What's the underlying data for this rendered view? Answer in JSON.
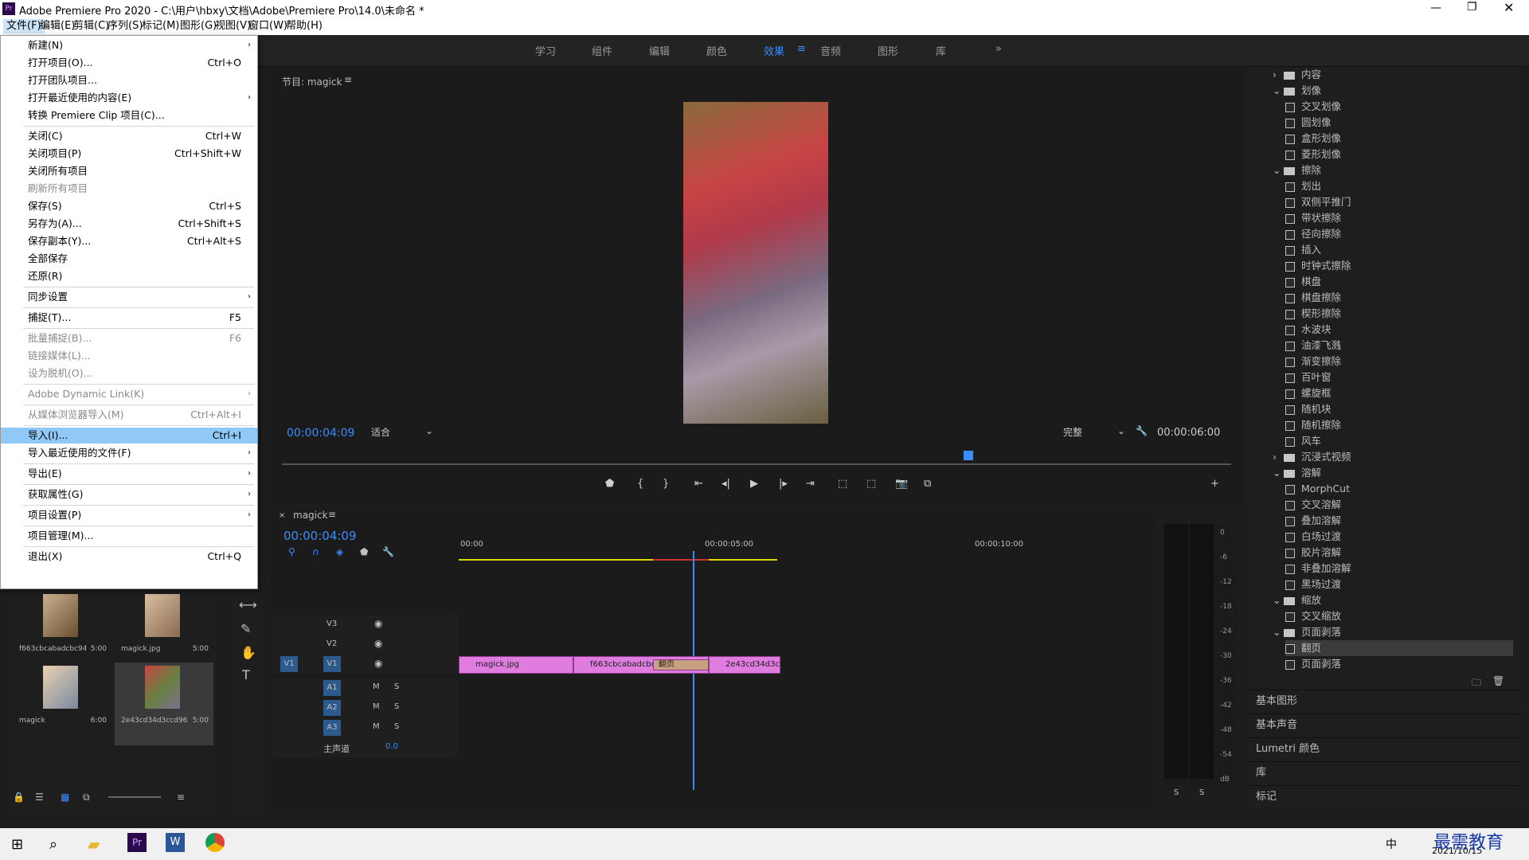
{
  "window": {
    "title": "Adobe Premiere Pro 2020 - C:\\用户\\hbxy\\文档\\Adobe\\Premiere Pro\\14.0\\未命名 *",
    "app_icon": "Pr"
  },
  "menubar": [
    "文件(F)",
    "编辑(E)",
    "剪辑(C)",
    "序列(S)",
    "标记(M)",
    "图形(G)",
    "视图(V)",
    "窗口(W)",
    "帮助(H)"
  ],
  "workspaces": [
    "学习",
    "组件",
    "编辑",
    "颜色",
    "效果",
    "音频",
    "图形",
    "库"
  ],
  "active_workspace": "效果",
  "file_menu": [
    {
      "label": "新建(N)",
      "shortcut": "",
      "arrow": true,
      "disabled": false
    },
    {
      "label": "打开项目(O)...",
      "shortcut": "Ctrl+O",
      "arrow": false,
      "disabled": false
    },
    {
      "label": "打开团队项目...",
      "shortcut": "",
      "arrow": false,
      "disabled": false
    },
    {
      "label": "打开最近使用的内容(E)",
      "shortcut": "",
      "arrow": true,
      "disabled": false
    },
    {
      "label": "转换 Premiere Clip 项目(C)...",
      "shortcut": "",
      "arrow": false,
      "disabled": false
    },
    {
      "label": "关闭(C)",
      "shortcut": "Ctrl+W",
      "arrow": false,
      "disabled": false
    },
    {
      "label": "关闭项目(P)",
      "shortcut": "Ctrl+Shift+W",
      "arrow": false,
      "disabled": false
    },
    {
      "label": "关闭所有项目",
      "shortcut": "",
      "arrow": false,
      "disabled": false
    },
    {
      "label": "刷新所有项目",
      "shortcut": "",
      "arrow": false,
      "disabled": true
    },
    {
      "label": "保存(S)",
      "shortcut": "Ctrl+S",
      "arrow": false,
      "disabled": false
    },
    {
      "label": "另存为(A)...",
      "shortcut": "Ctrl+Shift+S",
      "arrow": false,
      "disabled": false
    },
    {
      "label": "保存副本(Y)...",
      "shortcut": "Ctrl+Alt+S",
      "arrow": false,
      "disabled": false
    },
    {
      "label": "全部保存",
      "shortcut": "",
      "arrow": false,
      "disabled": false
    },
    {
      "label": "还原(R)",
      "shortcut": "",
      "arrow": false,
      "disabled": false
    },
    {
      "label": "同步设置",
      "shortcut": "",
      "arrow": true,
      "disabled": false
    },
    {
      "label": "捕捉(T)...",
      "shortcut": "F5",
      "arrow": false,
      "disabled": false
    },
    {
      "label": "批量捕捉(B)...",
      "shortcut": "F6",
      "arrow": false,
      "disabled": true
    },
    {
      "label": "链接媒体(L)...",
      "shortcut": "",
      "arrow": false,
      "disabled": true
    },
    {
      "label": "设为脱机(O)...",
      "shortcut": "",
      "arrow": false,
      "disabled": true
    },
    {
      "label": "Adobe Dynamic Link(K)",
      "shortcut": "",
      "arrow": true,
      "disabled": true
    },
    {
      "label": "从媒体浏览器导入(M)",
      "shortcut": "Ctrl+Alt+I",
      "arrow": false,
      "disabled": true
    },
    {
      "label": "导入(I)...",
      "shortcut": "Ctrl+I",
      "arrow": false,
      "disabled": false,
      "highlight": true
    },
    {
      "label": "导入最近使用的文件(F)",
      "shortcut": "",
      "arrow": true,
      "disabled": false
    },
    {
      "label": "导出(E)",
      "shortcut": "",
      "arrow": true,
      "disabled": false
    },
    {
      "label": "获取属性(G)",
      "shortcut": "",
      "arrow": true,
      "disabled": false
    },
    {
      "label": "项目设置(P)",
      "shortcut": "",
      "arrow": true,
      "disabled": false
    },
    {
      "label": "项目管理(M)...",
      "shortcut": "",
      "arrow": false,
      "disabled": false
    },
    {
      "label": "退出(X)",
      "shortcut": "Ctrl+Q",
      "arrow": false,
      "disabled": false
    }
  ],
  "program": {
    "title": "节目: magick",
    "timecode": "00:00:04:09",
    "fit": "适合",
    "quality": "完整",
    "duration": "00:00:06:00"
  },
  "timeline": {
    "tab": "magick",
    "timecode": "00:00:04:09",
    "ruler": [
      "00:00",
      "00:00:05:00",
      "00:00:10:00"
    ],
    "tracks": [
      {
        "name": "V3",
        "type": "video"
      },
      {
        "name": "V2",
        "type": "video"
      },
      {
        "name": "V1",
        "type": "video",
        "source": "V1"
      },
      {
        "name": "A1",
        "type": "audio"
      },
      {
        "name": "A2",
        "type": "audio"
      },
      {
        "name": "A3",
        "type": "audio"
      }
    ],
    "master": {
      "label": "主声道",
      "value": "0.0"
    },
    "clips": [
      {
        "label": "magick.jpg"
      },
      {
        "label": "f663cbcabadcbc9"
      },
      {
        "label": "翻页",
        "transition": true
      },
      {
        "label": "2e43cd34d3cc"
      }
    ]
  },
  "project_items": [
    {
      "name": "f663cbcabadcbc94...",
      "duration": "5:00"
    },
    {
      "name": "magick.jpg",
      "duration": "5:00"
    },
    {
      "name": "magick",
      "duration": "6:00"
    },
    {
      "name": "2e43cd34d3ccd96...",
      "duration": "5:00",
      "selected": true
    }
  ],
  "effects_tree": [
    {
      "label": "内容",
      "level": 0,
      "folder": true,
      "collapsed": true
    },
    {
      "label": "划像",
      "level": 0,
      "folder": true
    },
    {
      "label": "交叉划像",
      "level": 1
    },
    {
      "label": "圆划像",
      "level": 1
    },
    {
      "label": "盒形划像",
      "level": 1
    },
    {
      "label": "菱形划像",
      "level": 1
    },
    {
      "label": "擦除",
      "level": 0,
      "folder": true
    },
    {
      "label": "划出",
      "level": 1
    },
    {
      "label": "双侧平推门",
      "level": 1
    },
    {
      "label": "带状擦除",
      "level": 1
    },
    {
      "label": "径向擦除",
      "level": 1
    },
    {
      "label": "插入",
      "level": 1
    },
    {
      "label": "时钟式擦除",
      "level": 1
    },
    {
      "label": "棋盘",
      "level": 1
    },
    {
      "label": "棋盘擦除",
      "level": 1
    },
    {
      "label": "楔形擦除",
      "level": 1
    },
    {
      "label": "水波块",
      "level": 1
    },
    {
      "label": "油漆飞溅",
      "level": 1
    },
    {
      "label": "渐变擦除",
      "level": 1
    },
    {
      "label": "百叶窗",
      "level": 1
    },
    {
      "label": "螺旋框",
      "level": 1
    },
    {
      "label": "随机块",
      "level": 1
    },
    {
      "label": "随机擦除",
      "level": 1
    },
    {
      "label": "风车",
      "level": 1
    },
    {
      "label": "沉浸式视频",
      "level": 0,
      "folder": true,
      "collapsed": true
    },
    {
      "label": "溶解",
      "level": 0,
      "folder": true
    },
    {
      "label": "MorphCut",
      "level": 1
    },
    {
      "label": "交叉溶解",
      "level": 1
    },
    {
      "label": "叠加溶解",
      "level": 1
    },
    {
      "label": "白场过渡",
      "level": 1
    },
    {
      "label": "胶片溶解",
      "level": 1
    },
    {
      "label": "非叠加溶解",
      "level": 1
    },
    {
      "label": "黑场过渡",
      "level": 1
    },
    {
      "label": "缩放",
      "level": 0,
      "folder": true
    },
    {
      "label": "交叉缩放",
      "level": 1
    },
    {
      "label": "页面剥落",
      "level": 0,
      "folder": true
    },
    {
      "label": "翻页",
      "level": 1,
      "selected": true
    },
    {
      "label": "页面剥落",
      "level": 1
    }
  ],
  "side_panels": [
    "基本图形",
    "基本声音",
    "Lumetri 颜色",
    "库",
    "标记"
  ],
  "meter_scale": [
    "0",
    "-6",
    "-12",
    "-18",
    "-24",
    "-30",
    "-36",
    "-42",
    "-48",
    "-54",
    "dB"
  ],
  "meter_solo": [
    "S",
    "S"
  ],
  "taskbar": {
    "time": "",
    "date": "2021/10/15",
    "ime": "中",
    "watermark": "最需教育"
  },
  "colors": {
    "accent": "#3a8cff",
    "clip": "#e07be0",
    "highlight": "#90c8f6"
  }
}
